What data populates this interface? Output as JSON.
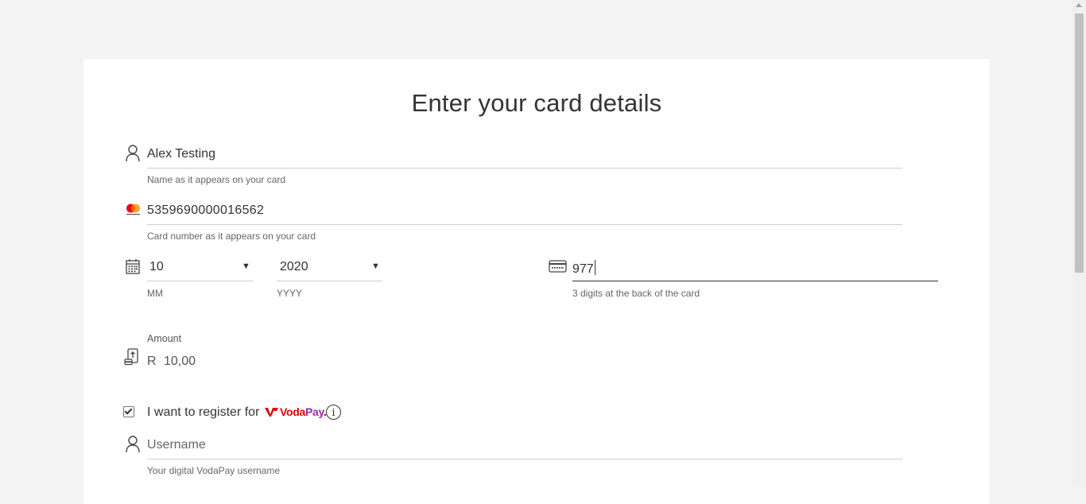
{
  "page": {
    "title": "Enter your card details"
  },
  "name_field": {
    "value": "Alex Testing",
    "helper": "Name as it appears on your card",
    "icon": "user-icon"
  },
  "card_field": {
    "value": "5359690000016562",
    "helper": "Card number as it appears on your card",
    "icon": "mastercard-icon",
    "brand_text": "mastercard"
  },
  "expiry": {
    "icon": "calendar-icon",
    "month": {
      "value": "10",
      "helper": "MM"
    },
    "year": {
      "value": "2020",
      "helper": "YYYY"
    }
  },
  "cvv_field": {
    "value": "977",
    "helper": "3 digits at the back of the card",
    "icon": "card-back-icon"
  },
  "amount": {
    "label": "Amount",
    "currency": "R",
    "value": "10,00",
    "icon": "money-hand-icon"
  },
  "register": {
    "checked": true,
    "text": "I want to register for",
    "brand_voda": "Voda",
    "brand_pay": "Pay",
    "brand_dot": ".",
    "info_glyph": "i"
  },
  "username_field": {
    "placeholder": "Username",
    "helper": "Your digital VodaPay username",
    "icon": "user-icon"
  },
  "colors": {
    "background": "#f4f4f4",
    "card": "#ffffff",
    "vodafone_red": "#e60000",
    "vodapay_purple": "#9c2aa0",
    "text": "#333333",
    "helper": "#666666"
  }
}
